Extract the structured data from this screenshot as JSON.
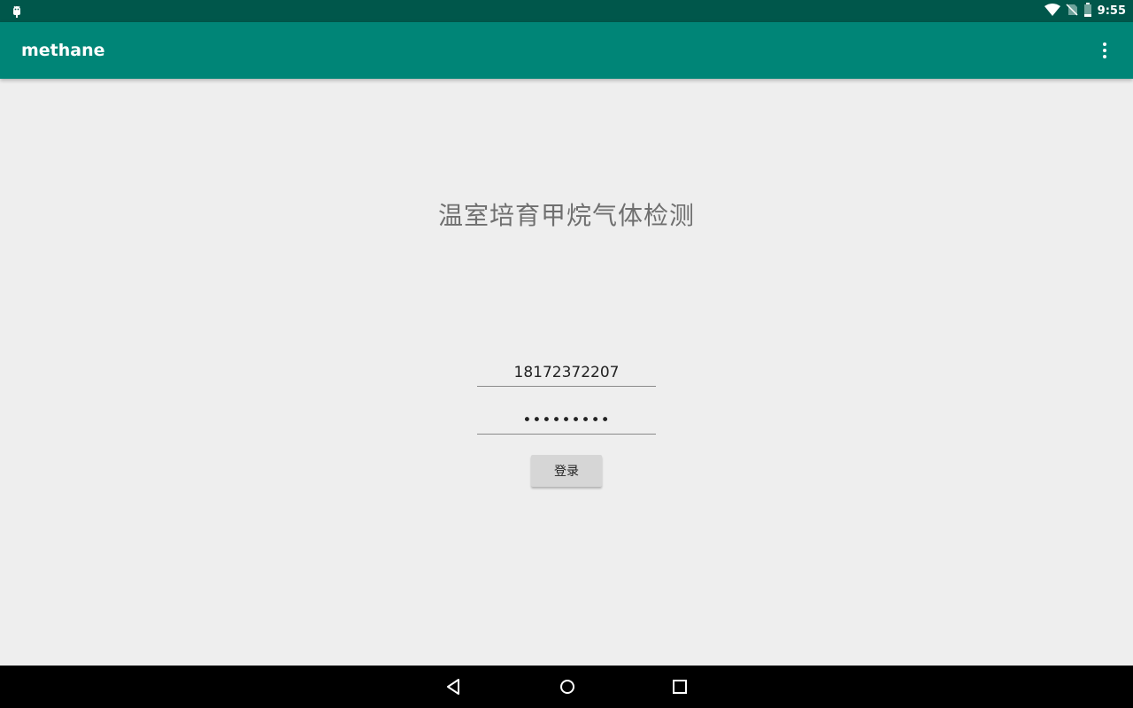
{
  "status_bar": {
    "time": "9:55",
    "icons": [
      "android-debug-icon",
      "wifi-icon",
      "no-sim-icon",
      "battery-icon"
    ]
  },
  "app_bar": {
    "title": "methane",
    "menu_icon": "more-vert-icon"
  },
  "login": {
    "heading": "温室培育甲烷气体检测",
    "phone_value": "18172372207",
    "password_value": "•••••••••",
    "login_label": "登录"
  },
  "nav_bar": {
    "icons": [
      "back-icon",
      "home-icon",
      "recents-icon"
    ]
  },
  "colors": {
    "status_bar": "#00574b",
    "app_bar": "#008577",
    "background": "#eeeeee",
    "button": "#d6d6d6"
  }
}
